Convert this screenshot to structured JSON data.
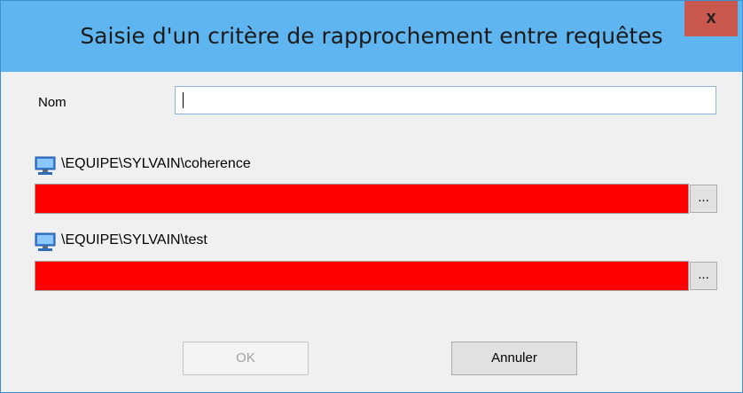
{
  "window": {
    "title": "Saisie d'un critère de rapprochement entre requêtes",
    "close_label": "x"
  },
  "form": {
    "name_label": "Nom",
    "name_value": ""
  },
  "queries": [
    {
      "icon": "computer-icon",
      "path": "\\EQUIPE\\SYLVAIN\\coherence",
      "browse_label": "..."
    },
    {
      "icon": "computer-icon",
      "path": "\\EQUIPE\\SYLVAIN\\test",
      "browse_label": "..."
    }
  ],
  "buttons": {
    "ok_label": "OK",
    "cancel_label": "Annuler"
  },
  "colors": {
    "titlebar": "#5eb5f0",
    "close_button": "#c9584f",
    "error_field": "#ff0000"
  }
}
